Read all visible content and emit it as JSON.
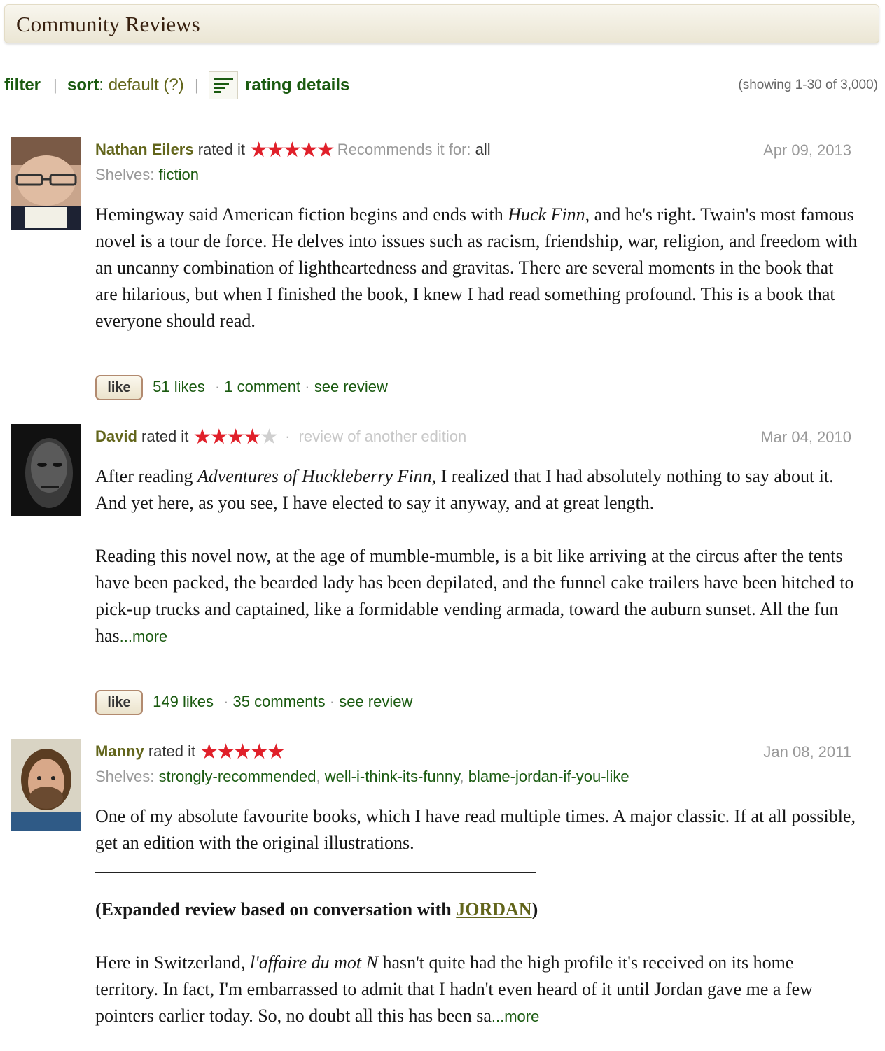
{
  "header": {
    "title": "Community Reviews"
  },
  "toolbar": {
    "filter_label": "filter",
    "sort_label": "sort",
    "sort_value": "default",
    "sort_help": "(?)",
    "rating_details_label": "rating details",
    "showing_text": "(showing 1-30 of 3,000)"
  },
  "reviews": [
    {
      "user": "Nathan Eilers",
      "rated_text": "rated it",
      "stars": 5,
      "recommends_label": "Recommends it for:",
      "recommends_value": "all",
      "date": "Apr 09, 2013",
      "shelves_label": "Shelves:",
      "shelves": [
        "fiction"
      ],
      "text_parts": {
        "p1": "Hemingway said American fiction begins and ends with ",
        "em1": "Huck Finn",
        "p2": ", and he's right. Twain's most famous novel is a tour de force. He delves into issues such as racism, friendship, war, religion, and freedom with an uncanny combination of lightheartedness and gravitas. There are several moments in the book that are hilarious, but when I finished the book, I knew I had read something profound. This is a book that everyone should read."
      },
      "like_label": "like",
      "likes": "51 likes",
      "comments": "1 comment",
      "see_review": "see review"
    },
    {
      "user": "David",
      "rated_text": "rated it",
      "stars": 4,
      "edition_note": "review of another edition",
      "date": "Mar 04, 2010",
      "text_parts": {
        "p1": "After reading ",
        "em1": "Adventures of Huckleberry Finn",
        "p2": ", I realized that I had absolutely nothing to say about it. And yet here, as you see, I have elected to say it anyway, and at great length.",
        "p3": "Reading this novel now, at the age of mumble-mumble, is a bit like arriving at the circus after the tents have been packed, the bearded lady has been depilated, and the funnel cake trailers have been hitched to pick-up trucks and captained, like a formidable vending armada, toward the auburn sunset. All the fun has"
      },
      "more_label": "...more",
      "like_label": "like",
      "likes": "149 likes",
      "comments": "35 comments",
      "see_review": "see review"
    },
    {
      "user": "Manny",
      "rated_text": "rated it",
      "stars": 5,
      "date": "Jan 08, 2011",
      "shelves_label": "Shelves:",
      "shelves": [
        "strongly-recommended",
        "well-i-think-its-funny",
        "blame-jordan-if-you-like"
      ],
      "text_parts": {
        "p1": "One of my absolute favourite books, which I have read multiple times. A major classic. If at all possible, get an edition with the original illustrations.",
        "bold_pre": "(Expanded review based on conversation with ",
        "bold_link": "JORDAN",
        "bold_post": ")",
        "p2a": "Here in Switzerland, ",
        "em1": "l'affaire du mot N",
        "p2b": " hasn't quite had the high profile it's received on its home territory. In fact, I'm embarrassed to admit that I hadn't even heard of it until Jordan gave me a few pointers earlier today. So, no doubt all this has been sa"
      },
      "more_label": "...more"
    }
  ],
  "colors": {
    "link_green": "#1a5a10",
    "user_olive": "#62651b",
    "star_red": "#e0202a",
    "header_text": "#382110"
  }
}
